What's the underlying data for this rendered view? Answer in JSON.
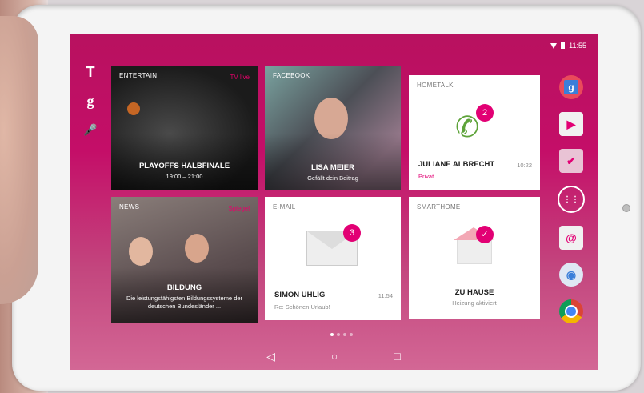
{
  "status": {
    "time": "11:55"
  },
  "left_icons": [
    "T",
    "g",
    "🎤"
  ],
  "tiles": {
    "entertain": {
      "label": "ENTERTAIN",
      "tag": "TV live",
      "title": "PLAYOFFS HALBFINALE",
      "subtitle": "19:00 – 21:00"
    },
    "facebook": {
      "label": "FACEBOOK",
      "title": "LISA MEIER",
      "subtitle": "Gefällt dein Beitrag"
    },
    "hometalk": {
      "label": "HOMETALK",
      "badge": "2",
      "name": "JULIANE ALBRECHT",
      "sub": "Privat",
      "time": "10:22"
    },
    "news": {
      "label": "NEWS",
      "tag": "Spiegel",
      "title": "BILDUNG",
      "subtitle": "Die leistungsfähigsten Bildungssysteme der deutschen Bundesländer ..."
    },
    "email": {
      "label": "E-MAIL",
      "badge": "3",
      "name": "SIMON UHLIG",
      "sub": "Re: Schönen Urlaub!",
      "time": "11:54"
    },
    "smarthome": {
      "label": "SMARTHOME",
      "name": "ZU HAUSE",
      "sub": "Heizung aktiviert"
    }
  },
  "right_apps": [
    "google-icon",
    "play-store-icon",
    "messages-icon",
    "apps-icon",
    "mail-icon",
    "maps-icon",
    "chrome-icon"
  ],
  "nav": {
    "back": "◁",
    "home": "○",
    "recent": "□"
  },
  "colors": {
    "magenta": "#e20074"
  }
}
